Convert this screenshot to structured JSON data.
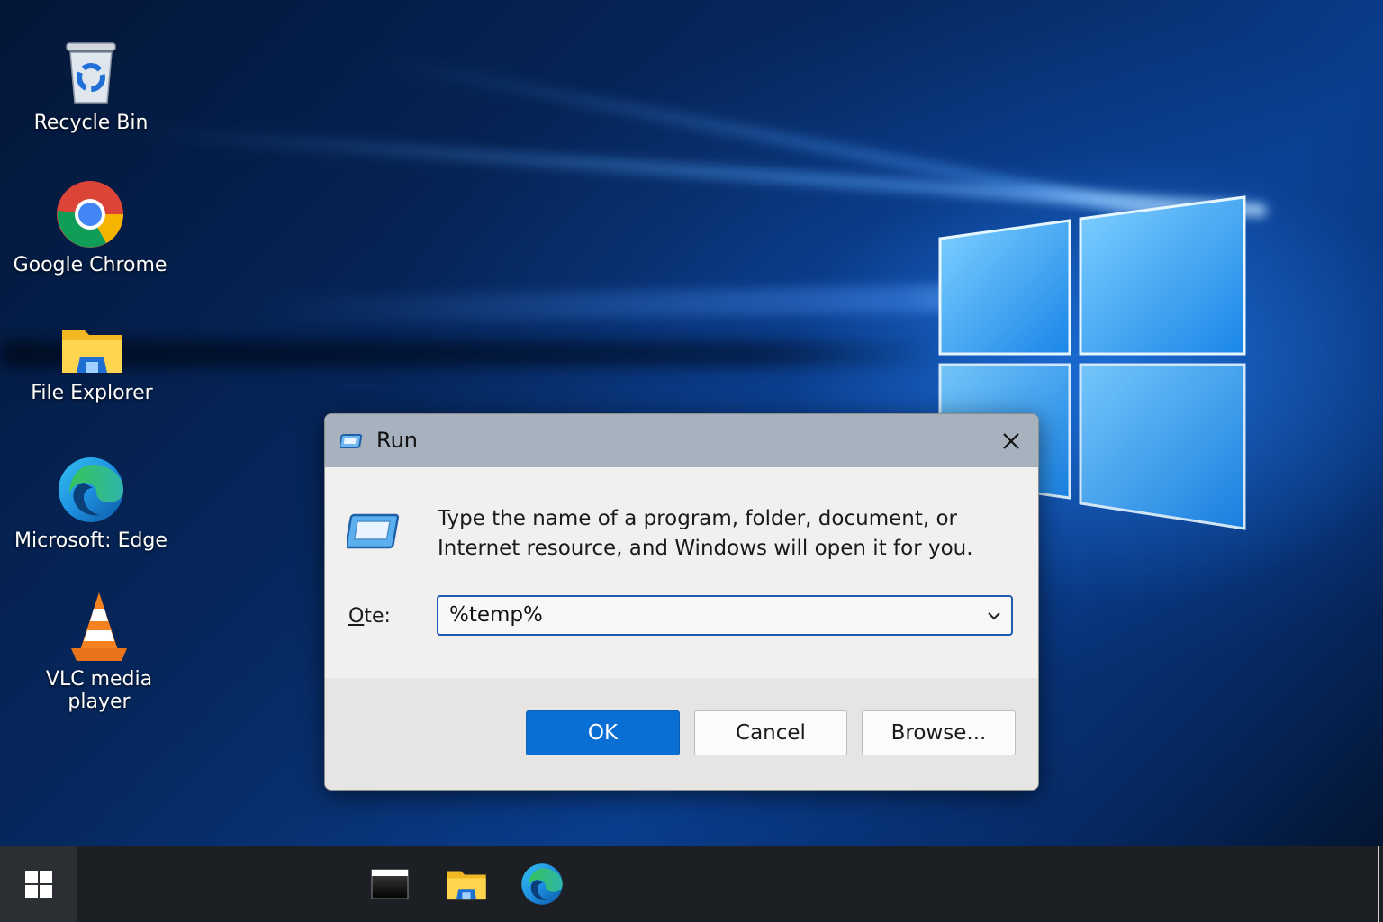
{
  "desktop": {
    "icons": [
      {
        "label": "Recycle Bin",
        "icon": "recycle-bin-icon"
      },
      {
        "label": "Google Chrome",
        "icon": "chrome-icon"
      },
      {
        "label": "File Explorer",
        "icon": "folder-icon"
      },
      {
        "label": "Microsoft: Edge",
        "icon": "edge-icon"
      },
      {
        "label": "VLC media player",
        "icon": "vlc-cone-icon"
      }
    ]
  },
  "run_dialog": {
    "title": "Run",
    "description": "Type the name of a program, folder, document, or Internet resource, and Windows will open it for you.",
    "open_label_mnemonic": "O",
    "open_label_rest": "te:",
    "open_value": "%temp%",
    "buttons": {
      "ok": "OK",
      "cancel": "Cancel",
      "browse": "Browse..."
    }
  },
  "taskbar": {
    "items": [
      {
        "name": "start",
        "icon": "windows-start-icon"
      },
      {
        "name": "terminal",
        "icon": "terminal-window-icon"
      },
      {
        "name": "file-explorer",
        "icon": "folder-icon"
      },
      {
        "name": "edge",
        "icon": "edge-icon"
      }
    ]
  },
  "colors": {
    "accent": "#0a6fd4",
    "titlebar": "#a8b2be",
    "dialog_bg": "#f1f0ef",
    "taskbar": "#1c1f24"
  }
}
